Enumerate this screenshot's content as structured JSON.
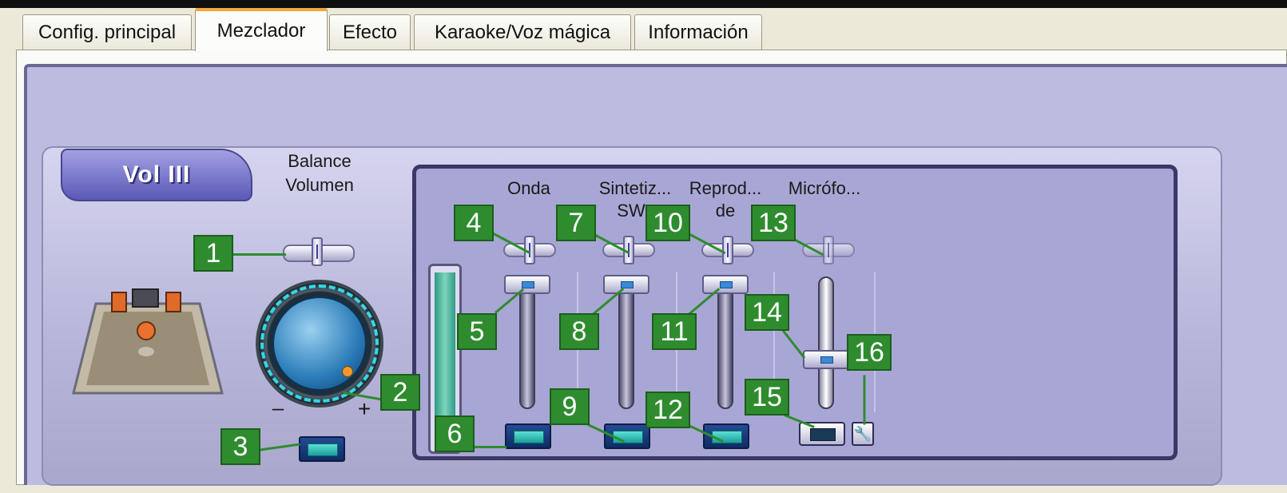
{
  "tabs": [
    {
      "label": "Config. principal",
      "active": false
    },
    {
      "label": "Mezclador",
      "active": true
    },
    {
      "label": "Efecto",
      "active": false
    },
    {
      "label": "Karaoke/Voz mágica",
      "active": false
    },
    {
      "label": "Información",
      "active": false
    }
  ],
  "vol_tab": "Vol III",
  "balance_label_line1": "Balance",
  "balance_label_line2": "Volumen",
  "knob_minus": "–",
  "knob_plus": "+",
  "channels": [
    {
      "label_line1": "Onda",
      "label_line2": ""
    },
    {
      "label_line1": "Sintetiz...",
      "label_line2": "SW"
    },
    {
      "label_line1": "Reprod...",
      "label_line2": "de"
    },
    {
      "label_line1": "Micrófo...",
      "label_line2": ""
    }
  ],
  "callouts": [
    "1",
    "2",
    "3",
    "4",
    "5",
    "6",
    "7",
    "8",
    "9",
    "10",
    "11",
    "12",
    "13",
    "14",
    "15",
    "16"
  ],
  "tool_icon": "wrench-icon",
  "colors": {
    "accent_tab": "#f2a838",
    "panel": "#bdbbe0",
    "callout": "#2e8c2e"
  }
}
